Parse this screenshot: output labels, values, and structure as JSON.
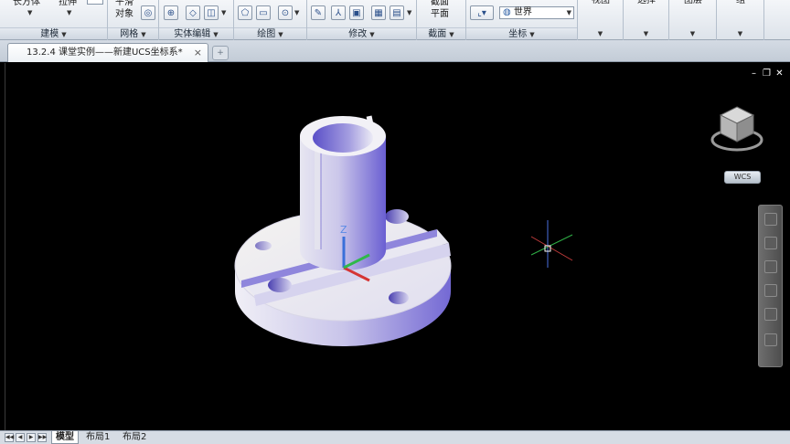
{
  "ribbon": {
    "panels": {
      "modeling": {
        "title": "建模",
        "box_label": "长方体",
        "extrude_label": "拉伸"
      },
      "mesh": {
        "title": "网格",
        "smooth_label_1": "平滑",
        "smooth_label_2": "对象"
      },
      "solid_edit": {
        "title": "实体编辑"
      },
      "draw": {
        "title": "绘图"
      },
      "modify": {
        "title": "修改"
      },
      "section": {
        "title": "截面",
        "plane_label_1": "截面",
        "plane_label_2": "平面"
      },
      "coordinates": {
        "title": "坐标",
        "ucs_value": "世界"
      },
      "view": {
        "title": "视图"
      },
      "selection": {
        "title": "选择"
      },
      "layers": {
        "title": "图层"
      },
      "groups": {
        "title": "组"
      }
    }
  },
  "document": {
    "tab_title": "13.2.4 课堂实例——新建UCS坐标系*",
    "close_symbol": "×",
    "new_tab_symbol": "+"
  },
  "canvas": {
    "background_color": "#000000",
    "model_fill_color": "#7b6fd6",
    "model_light_color": "#eeeef4",
    "crosshair_color": "#ffffff",
    "ucs_axis_labels": {
      "z": "Z"
    },
    "viewcube_label": "WCS",
    "window_controls": [
      "–",
      "❐",
      "✕"
    ]
  },
  "layout_tabs": {
    "items": [
      "模型",
      "布局1",
      "布局2"
    ],
    "active": "模型"
  }
}
